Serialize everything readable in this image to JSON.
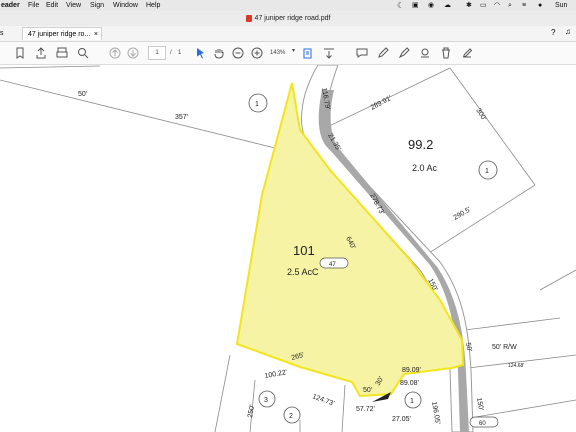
{
  "menubar": {
    "app": "eader",
    "items": [
      "File",
      "Edit",
      "View",
      "Sign",
      "Window",
      "Help"
    ],
    "clock": "Sun"
  },
  "window": {
    "title": "47 juniper ridge road.pdf"
  },
  "tabs": {
    "partial": "s",
    "active": "47 juniper ridge ro..."
  },
  "toolbar": {
    "page_current": "1",
    "page_sep": "/",
    "page_total": "1",
    "zoom": "143%"
  },
  "map": {
    "labels": {
      "dim_50": "50'",
      "dim_357": "357'",
      "parcel_1_top": "1",
      "dim_116": "116.79'",
      "dim_289": "289.91'",
      "dim_300": "300'",
      "dim_21": "21.35'",
      "lot_992": "99.2",
      "area_992": "2.0 Ac",
      "parcel_1_right": "1",
      "dim_278": "278.73'",
      "dim_2905": "290.5'",
      "lot_101": "101",
      "area_101": "2.5 AcC",
      "dim_640": "640'",
      "house_47": "47",
      "dim_150a": "150'",
      "dim_50b": "50'",
      "row": "50' R/W",
      "dim_124": "124.68'",
      "dim_265": "265'",
      "dim_8909": "89.09'",
      "dim_30": "30'",
      "dim_50c": "50'",
      "dim_8908": "89.08'",
      "dim_10022": "100.22'",
      "dim_12473": "124.73'",
      "parcel_3": "3",
      "parcel_2": "2",
      "parcel_1_bottom": "1",
      "dim_5772": "57.72'",
      "dim_2705": "27.05'",
      "dim_19605": "196.05'",
      "dim_150b": "150'",
      "dim_250": "250'",
      "parcel_60": "60"
    }
  },
  "colors": {
    "highlight_fill": "#f7f3a4",
    "highlight_stroke": "#f2e51c",
    "road": "#9a9a9a"
  }
}
